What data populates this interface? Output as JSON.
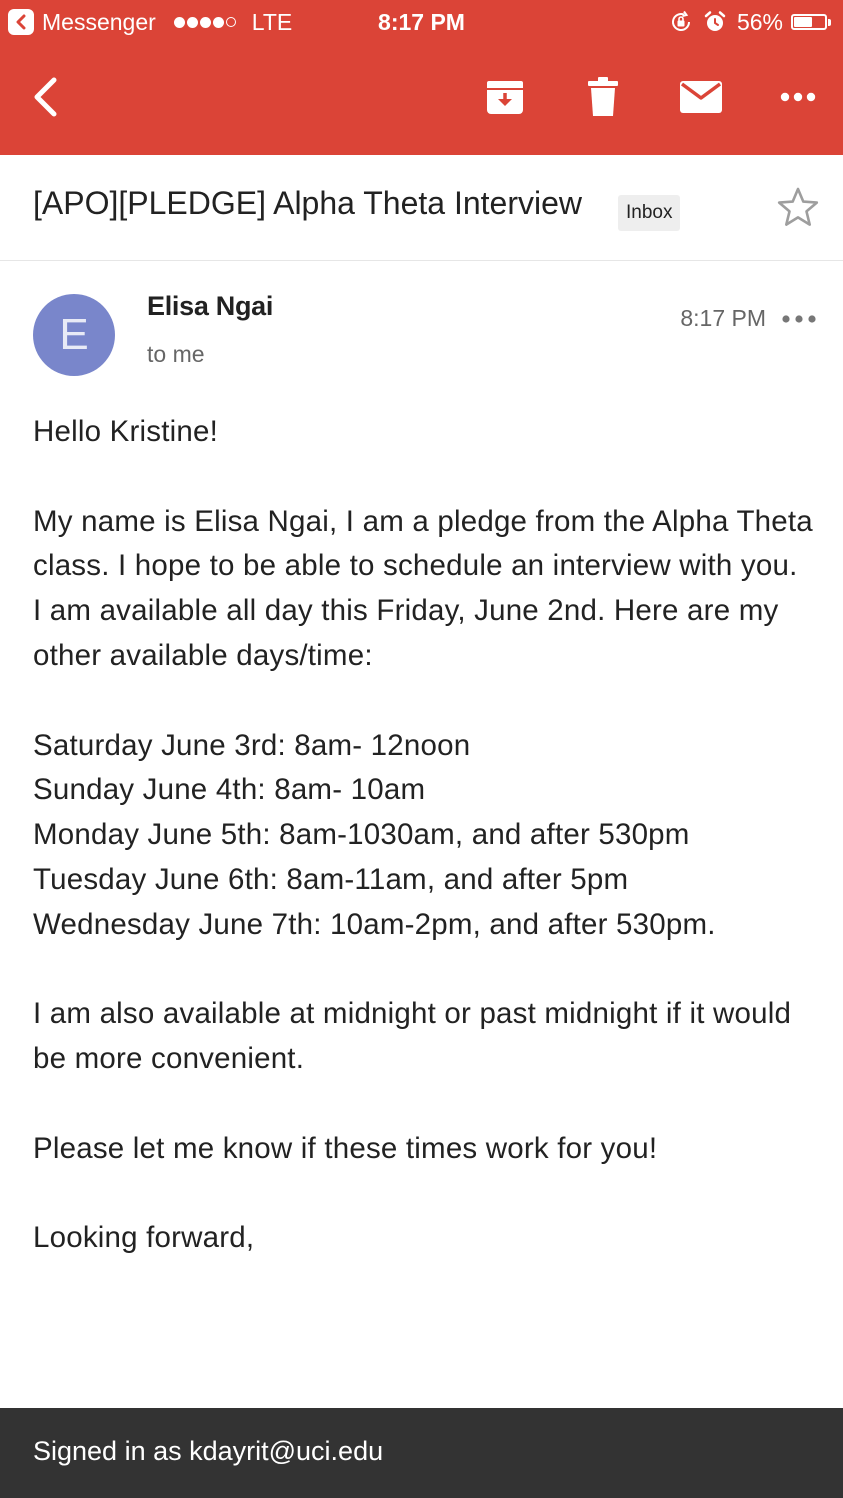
{
  "status_bar": {
    "back_app": "Messenger",
    "carrier": "LTE",
    "time": "8:17 PM",
    "battery": "56%",
    "battery_level": 0.56
  },
  "toolbar": {
    "back_icon": "chevron-left-icon",
    "archive_icon": "archive-icon",
    "delete_icon": "trash-icon",
    "mark_unread_icon": "mail-icon",
    "more_icon": "more-horizontal-icon"
  },
  "email": {
    "subject": "[APO][PLEDGE] Alpha Theta Interview",
    "label": "Inbox",
    "sender": {
      "initial": "E",
      "name": "Elisa Ngai",
      "recipient": "to me",
      "time": "8:17 PM"
    },
    "body": {
      "greeting": "Hello Kristine!",
      "intro": "My name is Elisa Ngai, I am a pledge from the Alpha Theta class. I hope to be able to schedule an interview with you. I am available all day this Friday, June 2nd. Here are my other available days/time:",
      "schedule": [
        "Saturday June 3rd: 8am- 12noon",
        "Sunday June 4th: 8am- 10am",
        "Monday June 5th: 8am-1030am, and after 530pm",
        "Tuesday June 6th: 8am-11am, and after 5pm",
        "Wednesday June 7th: 10am-2pm, and after 530pm."
      ],
      "extra": "I am also available at midnight or past midnight if it would be more convenient.",
      "request": "Please let me know if these times work for you!",
      "closing": "Looking forward,"
    }
  },
  "footer": {
    "signed_in": "Signed in as kdayrit@uci.edu"
  },
  "colors": {
    "header": "#db4437",
    "avatar": "#7986cb",
    "footer": "#333333"
  }
}
